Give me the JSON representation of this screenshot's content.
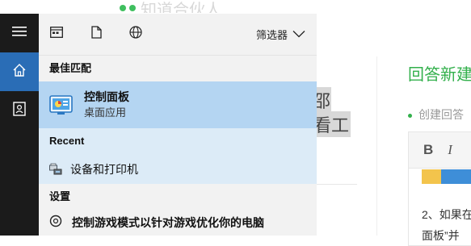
{
  "background": {
    "logo_text": "知道合伙人",
    "answer_title": "回答新建",
    "create_text": "创建回答",
    "frag_top": "邵",
    "frag_bottom": "看工",
    "editor": {
      "bold": "B",
      "italic": "I",
      "line1": "2、如果在",
      "line2": "面板”并"
    }
  },
  "start_menu": {
    "filter_label": "筛选器",
    "best_match_heading": "最佳匹配",
    "best_match": {
      "title": "控制面板",
      "subtitle": "桌面应用"
    },
    "recent_heading": "Recent",
    "recent_items": [
      {
        "label": "设备和打印机"
      }
    ],
    "settings_heading": "设置",
    "settings_items": [
      {
        "label": "控制游戏模式以针对游戏优化你的电脑"
      }
    ]
  },
  "colors": {
    "rail": "#1b1b1b",
    "rail_active": "#2a6db6",
    "panel": "#f2f2f2",
    "best_match_bg": "#b4d5f2",
    "recent_bg": "#dcebf7",
    "accent_green": "#33b04c"
  },
  "icons": {
    "rail": [
      "hamburger-icon",
      "home-icon",
      "user-account-icon"
    ],
    "topbar": [
      "apps-icon",
      "document-icon",
      "web-globe-icon"
    ],
    "filter": "chevron-down-icon",
    "best_match": "control-panel-icon",
    "recent": "devices-printers-icon",
    "settings": "game-mode-icon"
  }
}
